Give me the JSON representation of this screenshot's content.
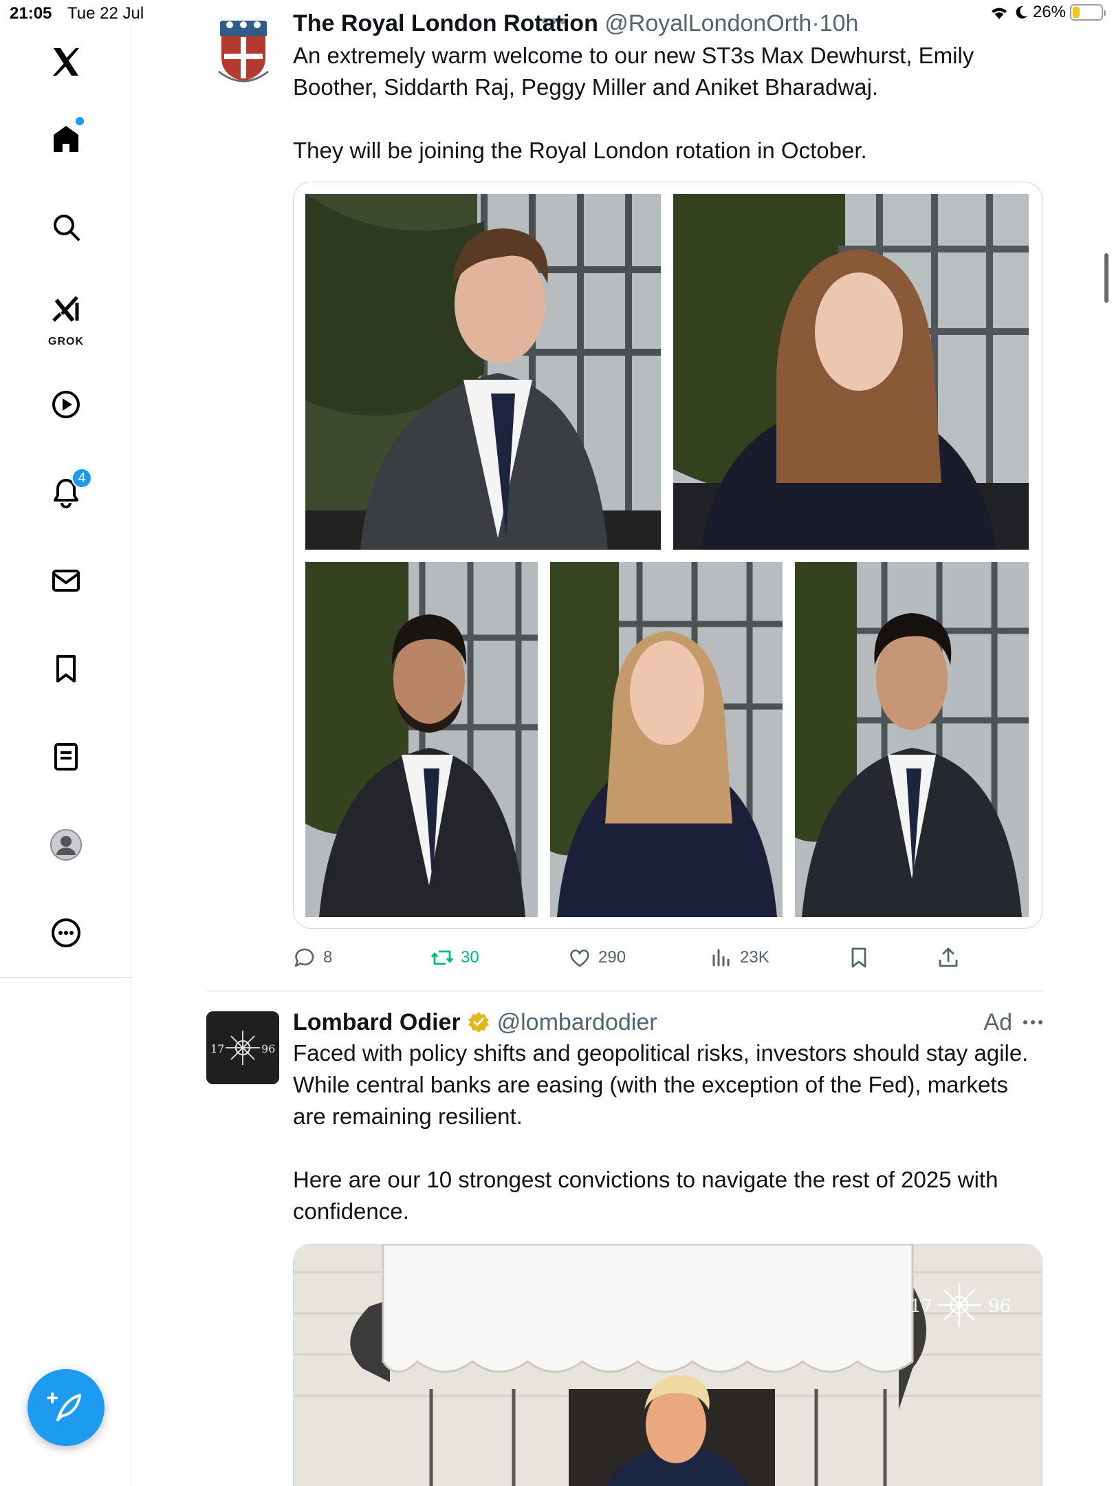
{
  "status_bar": {
    "time": "21:05",
    "date": "Tue 22 Jul",
    "battery": "26%"
  },
  "nav": {
    "grok_label": "GROK",
    "notifications_badge": "4"
  },
  "feed": {
    "tweet1": {
      "name": "The Royal London Rotation",
      "handle": "@RoyalLondonOrth",
      "separator": "·",
      "time": "10h",
      "paragraphs": [
        "An extremely warm welcome to our new ST3s Max Dewhurst, Emily Boother, Siddarth Raj, Peggy Miller and Aniket Bharadwaj.",
        "They will be joining the Royal London rotation in October."
      ],
      "stats": {
        "replies": "8",
        "reposts": "30",
        "likes": "290",
        "views": "23K"
      }
    },
    "tweet2": {
      "name": "Lombard Odier",
      "handle": "@lombardodier",
      "ad_label": "Ad",
      "logo_left": "17",
      "logo_right": "96",
      "paragraphs": [
        "Faced with policy shifts and geopolitical risks, investors should stay agile. While central banks are easing (with the exception of the Fed), markets are remaining resilient.",
        "Here are our 10 strongest convictions to navigate the rest of 2025 with confidence."
      ],
      "image_watermark_left": "17",
      "image_watermark_right": "96"
    }
  },
  "colors": {
    "accent": "#1d9bf0",
    "repost_green": "#00ba7c",
    "secondary_text": "#536471",
    "verified_gold": "#e2b719"
  }
}
